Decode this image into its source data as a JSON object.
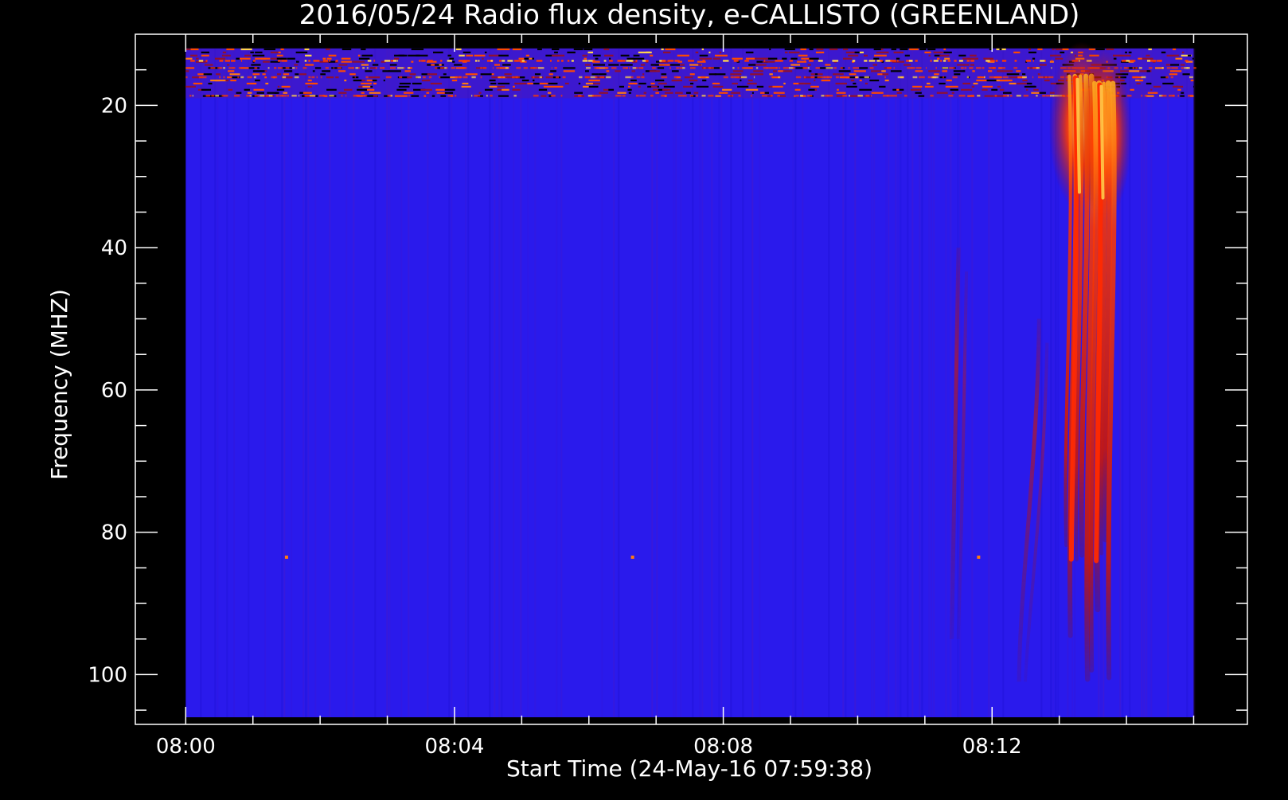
{
  "chart_data": {
    "type": "heatmap",
    "title": "2016/05/24  Radio flux density, e-CALLISTO (GREENLAND)",
    "xlabel": "Start Time (24-May-16 07:59:38)",
    "ylabel": "Frequency (MHZ)",
    "x_ticks": [
      "08:00",
      "08:04",
      "08:08",
      "08:12"
    ],
    "x_tick_minutes": [
      0,
      4,
      8,
      12
    ],
    "xlim_minutes": [
      -0.75,
      15.8
    ],
    "data_xlim_minutes": [
      0,
      15.0
    ],
    "y_ticks": [
      20,
      40,
      60,
      80,
      100
    ],
    "ylim": [
      10,
      107
    ],
    "data_ylim": [
      12,
      106
    ],
    "y_reversed": true,
    "grid": false,
    "colormap": {
      "background": "#2a1aec",
      "low": "#3a10e0",
      "mid": "#b0100a",
      "high": "#ff3300",
      "peak": "#ffd34d"
    },
    "features": [
      {
        "kind": "rfi_band",
        "freq_range": [
          12,
          19
        ],
        "time_range": [
          0,
          15.0
        ],
        "note": "interference band with bright streaks"
      },
      {
        "kind": "type_iii_burst",
        "time_start": 13.0,
        "time_end": 13.6,
        "freq_top": 15,
        "freq_bottom": 101
      },
      {
        "kind": "type_iii_burst",
        "time_start": 13.4,
        "time_end": 13.9,
        "freq_top": 16,
        "freq_bottom": 101
      },
      {
        "kind": "faint_drift",
        "time_start": 11.4,
        "time_end": 11.5,
        "freq_top": 40,
        "freq_bottom": 95
      },
      {
        "kind": "faint_drift",
        "time_start": 12.4,
        "time_end": 12.7,
        "freq_top": 50,
        "freq_bottom": 101
      },
      {
        "kind": "spike",
        "time": 1.5,
        "freq": 83.5
      },
      {
        "kind": "spike",
        "time": 6.65,
        "freq": 83.5
      },
      {
        "kind": "spike",
        "time": 11.8,
        "freq": 83.5
      }
    ]
  }
}
